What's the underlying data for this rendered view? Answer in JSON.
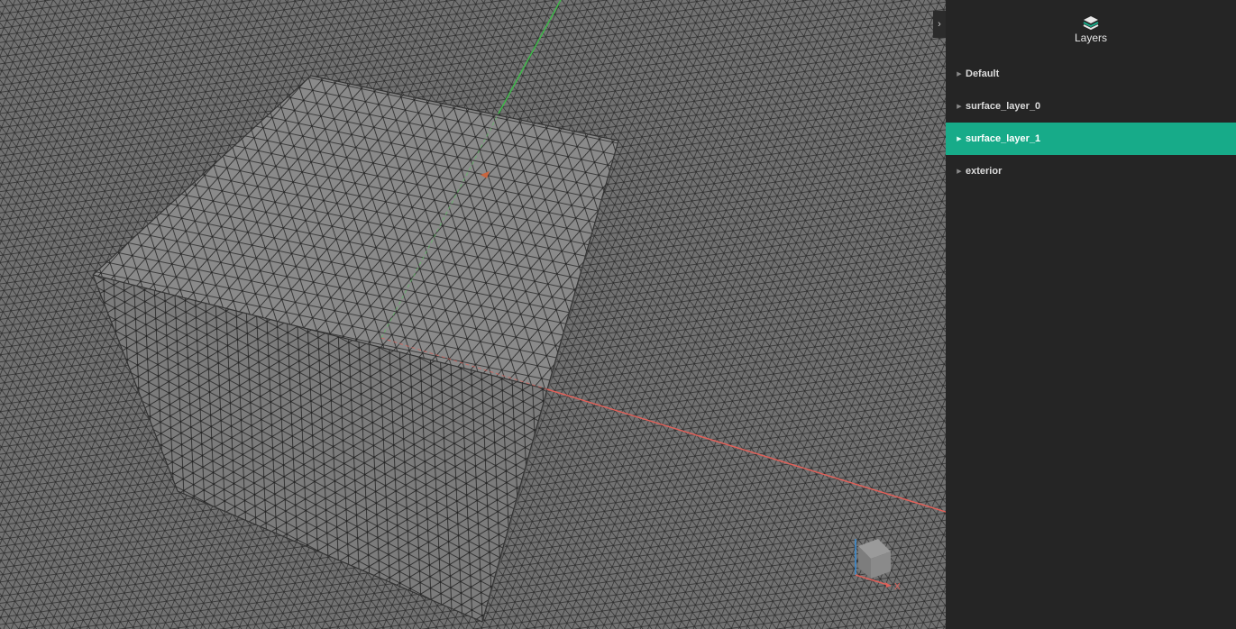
{
  "panel": {
    "title": "Layers",
    "toggle_glyph": "›",
    "icon": "layers-icon",
    "items": [
      {
        "label": "Default",
        "active": false
      },
      {
        "label": "surface_layer_0",
        "active": false
      },
      {
        "label": "surface_layer_1",
        "active": true
      },
      {
        "label": "exterior",
        "active": false
      }
    ]
  },
  "gizmo": {
    "x_label": "X"
  },
  "colors": {
    "accent": "#17ab89",
    "panel_bg": "#252525",
    "mesh_bg": "#707070",
    "x_axis": "#e0615a",
    "y_axis": "#3fb84a",
    "z_axis": "#3a8fd8"
  }
}
